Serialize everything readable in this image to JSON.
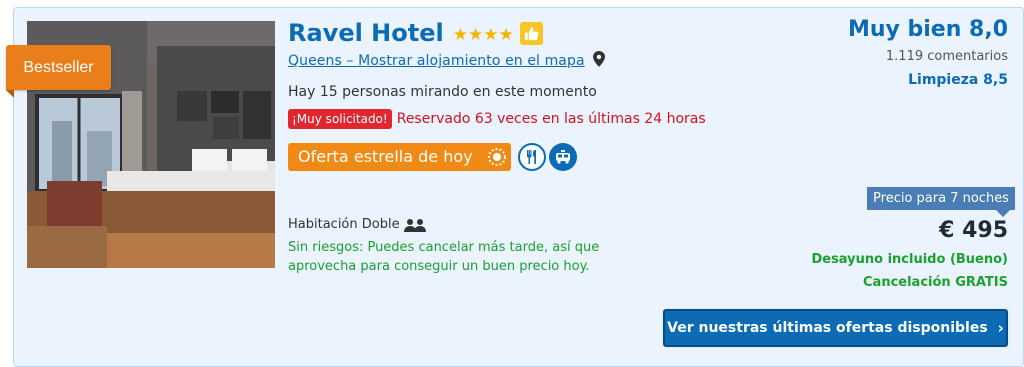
{
  "hotel": {
    "name": "Ravel Hotel",
    "stars": "★★★★",
    "ribbon": "Bestseller",
    "location_link": "Queens – Mostrar alojamiento en el mapa",
    "viewers": "Hay 15 personas mirando en este momento",
    "demand_badge": "¡Muy solicitado!",
    "demand_text": "Reservado 63 veces en las últimas 24 horas",
    "deal_badge": "Oferta estrella de hoy",
    "room_type": "Habitación Doble",
    "free_cancel_text": "Sin riesgos: Puedes cancelar más tarde, así que aprovecha para conseguir un buen precio hoy."
  },
  "rating": {
    "label": "Muy bien 8,0",
    "reviews": "1.119 comentarios",
    "cleanliness": "Limpieza 8,5"
  },
  "pricing": {
    "nights_label": "Precio para 7 noches",
    "price": "€ 495",
    "breakfast": "Desayuno incluido (Bueno)",
    "cancellation": "Cancelación GRATIS"
  },
  "cta": {
    "label": "Ver nuestras últimas ofertas disponibles",
    "chevron": "›"
  },
  "icons": {
    "thumb": "thumbs-up-icon",
    "pin": "map-pin-icon",
    "deal": "deal-icon",
    "restaurant": "restaurant-icon",
    "shuttle": "shuttle-icon",
    "guests": "guests-icon"
  },
  "colors": {
    "brand_blue": "#0b6cb5",
    "orange": "#f18a14",
    "green": "#1aa12e",
    "red": "#e0262f"
  }
}
